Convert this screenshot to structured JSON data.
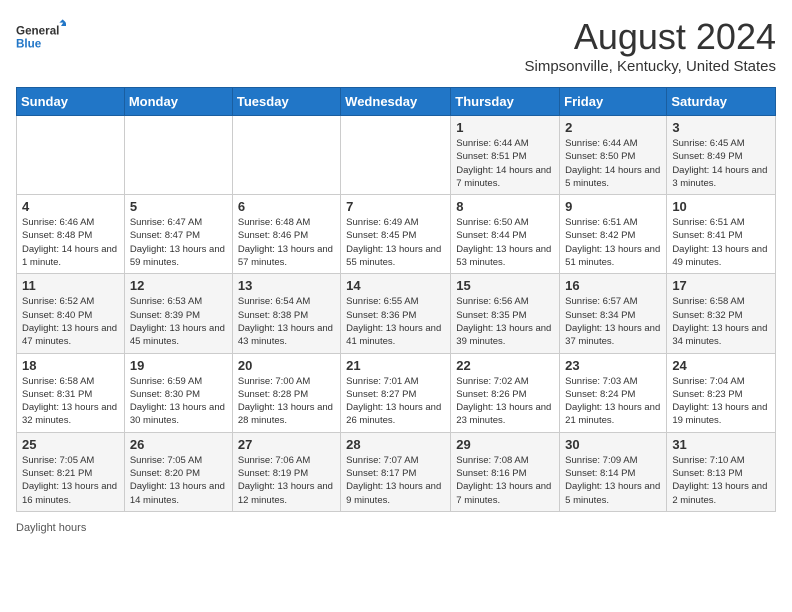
{
  "header": {
    "logo_general": "General",
    "logo_blue": "Blue",
    "month_year": "August 2024",
    "location": "Simpsonville, Kentucky, United States"
  },
  "days_of_week": [
    "Sunday",
    "Monday",
    "Tuesday",
    "Wednesday",
    "Thursday",
    "Friday",
    "Saturday"
  ],
  "weeks": [
    [
      {
        "day": "",
        "sunrise": "",
        "sunset": "",
        "daylight": ""
      },
      {
        "day": "",
        "sunrise": "",
        "sunset": "",
        "daylight": ""
      },
      {
        "day": "",
        "sunrise": "",
        "sunset": "",
        "daylight": ""
      },
      {
        "day": "",
        "sunrise": "",
        "sunset": "",
        "daylight": ""
      },
      {
        "day": "1",
        "sunrise": "6:44 AM",
        "sunset": "8:51 PM",
        "daylight": "14 hours and 7 minutes."
      },
      {
        "day": "2",
        "sunrise": "6:44 AM",
        "sunset": "8:50 PM",
        "daylight": "14 hours and 5 minutes."
      },
      {
        "day": "3",
        "sunrise": "6:45 AM",
        "sunset": "8:49 PM",
        "daylight": "14 hours and 3 minutes."
      }
    ],
    [
      {
        "day": "4",
        "sunrise": "6:46 AM",
        "sunset": "8:48 PM",
        "daylight": "14 hours and 1 minute."
      },
      {
        "day": "5",
        "sunrise": "6:47 AM",
        "sunset": "8:47 PM",
        "daylight": "13 hours and 59 minutes."
      },
      {
        "day": "6",
        "sunrise": "6:48 AM",
        "sunset": "8:46 PM",
        "daylight": "13 hours and 57 minutes."
      },
      {
        "day": "7",
        "sunrise": "6:49 AM",
        "sunset": "8:45 PM",
        "daylight": "13 hours and 55 minutes."
      },
      {
        "day": "8",
        "sunrise": "6:50 AM",
        "sunset": "8:44 PM",
        "daylight": "13 hours and 53 minutes."
      },
      {
        "day": "9",
        "sunrise": "6:51 AM",
        "sunset": "8:42 PM",
        "daylight": "13 hours and 51 minutes."
      },
      {
        "day": "10",
        "sunrise": "6:51 AM",
        "sunset": "8:41 PM",
        "daylight": "13 hours and 49 minutes."
      }
    ],
    [
      {
        "day": "11",
        "sunrise": "6:52 AM",
        "sunset": "8:40 PM",
        "daylight": "13 hours and 47 minutes."
      },
      {
        "day": "12",
        "sunrise": "6:53 AM",
        "sunset": "8:39 PM",
        "daylight": "13 hours and 45 minutes."
      },
      {
        "day": "13",
        "sunrise": "6:54 AM",
        "sunset": "8:38 PM",
        "daylight": "13 hours and 43 minutes."
      },
      {
        "day": "14",
        "sunrise": "6:55 AM",
        "sunset": "8:36 PM",
        "daylight": "13 hours and 41 minutes."
      },
      {
        "day": "15",
        "sunrise": "6:56 AM",
        "sunset": "8:35 PM",
        "daylight": "13 hours and 39 minutes."
      },
      {
        "day": "16",
        "sunrise": "6:57 AM",
        "sunset": "8:34 PM",
        "daylight": "13 hours and 37 minutes."
      },
      {
        "day": "17",
        "sunrise": "6:58 AM",
        "sunset": "8:32 PM",
        "daylight": "13 hours and 34 minutes."
      }
    ],
    [
      {
        "day": "18",
        "sunrise": "6:58 AM",
        "sunset": "8:31 PM",
        "daylight": "13 hours and 32 minutes."
      },
      {
        "day": "19",
        "sunrise": "6:59 AM",
        "sunset": "8:30 PM",
        "daylight": "13 hours and 30 minutes."
      },
      {
        "day": "20",
        "sunrise": "7:00 AM",
        "sunset": "8:28 PM",
        "daylight": "13 hours and 28 minutes."
      },
      {
        "day": "21",
        "sunrise": "7:01 AM",
        "sunset": "8:27 PM",
        "daylight": "13 hours and 26 minutes."
      },
      {
        "day": "22",
        "sunrise": "7:02 AM",
        "sunset": "8:26 PM",
        "daylight": "13 hours and 23 minutes."
      },
      {
        "day": "23",
        "sunrise": "7:03 AM",
        "sunset": "8:24 PM",
        "daylight": "13 hours and 21 minutes."
      },
      {
        "day": "24",
        "sunrise": "7:04 AM",
        "sunset": "8:23 PM",
        "daylight": "13 hours and 19 minutes."
      }
    ],
    [
      {
        "day": "25",
        "sunrise": "7:05 AM",
        "sunset": "8:21 PM",
        "daylight": "13 hours and 16 minutes."
      },
      {
        "day": "26",
        "sunrise": "7:05 AM",
        "sunset": "8:20 PM",
        "daylight": "13 hours and 14 minutes."
      },
      {
        "day": "27",
        "sunrise": "7:06 AM",
        "sunset": "8:19 PM",
        "daylight": "13 hours and 12 minutes."
      },
      {
        "day": "28",
        "sunrise": "7:07 AM",
        "sunset": "8:17 PM",
        "daylight": "13 hours and 9 minutes."
      },
      {
        "day": "29",
        "sunrise": "7:08 AM",
        "sunset": "8:16 PM",
        "daylight": "13 hours and 7 minutes."
      },
      {
        "day": "30",
        "sunrise": "7:09 AM",
        "sunset": "8:14 PM",
        "daylight": "13 hours and 5 minutes."
      },
      {
        "day": "31",
        "sunrise": "7:10 AM",
        "sunset": "8:13 PM",
        "daylight": "13 hours and 2 minutes."
      }
    ]
  ],
  "footer": {
    "daylight_hours_label": "Daylight hours"
  }
}
